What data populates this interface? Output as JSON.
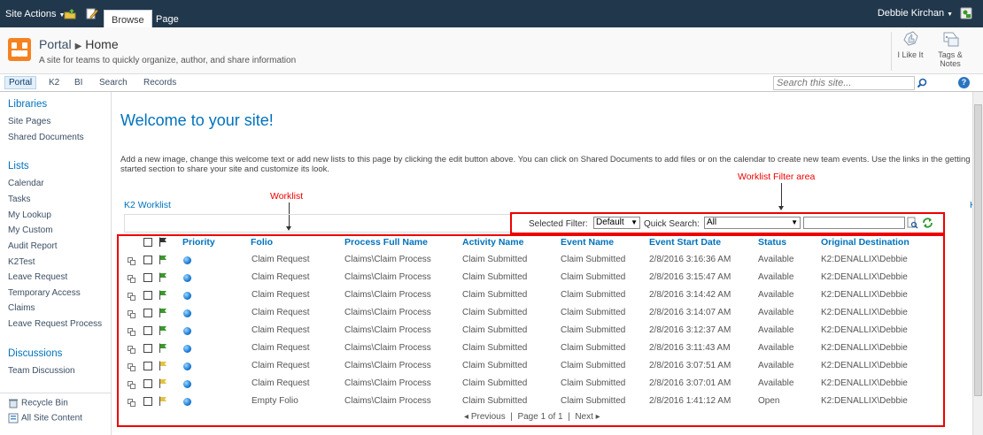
{
  "ribbon": {
    "site_actions": "Site Actions",
    "tabs": [
      "Browse",
      "Page"
    ],
    "user": "Debbie Kirchan"
  },
  "titlearea": {
    "site": "Portal",
    "page": "Home",
    "description": "A site for teams to quickly organize, author, and share information",
    "like_label": "I Like It",
    "tags_label_1": "Tags &",
    "tags_label_2": "Notes"
  },
  "topnav": {
    "items": [
      "Portal",
      "K2",
      "BI",
      "Search",
      "Records"
    ],
    "search_placeholder": "Search this site..."
  },
  "leftnav": {
    "libraries_head": "Libraries",
    "libraries": [
      "Site Pages",
      "Shared Documents"
    ],
    "lists_head": "Lists",
    "lists": [
      "Calendar",
      "Tasks",
      "My Lookup",
      "My Custom",
      "Audit Report",
      "K2Test",
      "Leave Request",
      "Temporary Access",
      "Claims",
      "Leave Request Process"
    ],
    "discussions_head": "Discussions",
    "discussions": [
      "Team Discussion"
    ],
    "recycle": "Recycle Bin",
    "all_content": "All Site Content"
  },
  "main": {
    "welcome": "Welcome to your site!",
    "body": "Add a new image, change this welcome text or add new lists to this page by clicking the edit button above. You can click on Shared Documents to add files or on the calendar to create new team events. Use the links in the getting started section to share your site and customize its look.",
    "k2_title": "K2 Worklist",
    "cut_letter": "K"
  },
  "annotations": {
    "worklist": "Worklist",
    "filter_area": "Worklist Filter area"
  },
  "filter": {
    "selected_label": "Selected Filter:",
    "selected_value": "Default",
    "quick_label": "Quick Search:",
    "quick_value": "All"
  },
  "worklist": {
    "columns": [
      "Priority",
      "Folio",
      "Process Full Name",
      "Activity Name",
      "Event Name",
      "Event Start Date",
      "Status",
      "Original Destination"
    ],
    "rows": [
      {
        "flag": "green",
        "folio": "Claim Request",
        "process": "Claims\\Claim Process",
        "activity": "Claim Submitted",
        "event": "Claim Submitted",
        "start": "2/8/2016 3:16:36 AM",
        "status": "Available",
        "dest": "K2:DENALLIX\\Debbie"
      },
      {
        "flag": "green",
        "folio": "Claim Request",
        "process": "Claims\\Claim Process",
        "activity": "Claim Submitted",
        "event": "Claim Submitted",
        "start": "2/8/2016 3:15:47 AM",
        "status": "Available",
        "dest": "K2:DENALLIX\\Debbie"
      },
      {
        "flag": "green",
        "folio": "Claim Request",
        "process": "Claims\\Claim Process",
        "activity": "Claim Submitted",
        "event": "Claim Submitted",
        "start": "2/8/2016 3:14:42 AM",
        "status": "Available",
        "dest": "K2:DENALLIX\\Debbie"
      },
      {
        "flag": "green",
        "folio": "Claim Request",
        "process": "Claims\\Claim Process",
        "activity": "Claim Submitted",
        "event": "Claim Submitted",
        "start": "2/8/2016 3:14:07 AM",
        "status": "Available",
        "dest": "K2:DENALLIX\\Debbie"
      },
      {
        "flag": "green",
        "folio": "Claim Request",
        "process": "Claims\\Claim Process",
        "activity": "Claim Submitted",
        "event": "Claim Submitted",
        "start": "2/8/2016 3:12:37 AM",
        "status": "Available",
        "dest": "K2:DENALLIX\\Debbie"
      },
      {
        "flag": "green",
        "folio": "Claim Request",
        "process": "Claims\\Claim Process",
        "activity": "Claim Submitted",
        "event": "Claim Submitted",
        "start": "2/8/2016 3:11:43 AM",
        "status": "Available",
        "dest": "K2:DENALLIX\\Debbie"
      },
      {
        "flag": "yellow",
        "folio": "Claim Request",
        "process": "Claims\\Claim Process",
        "activity": "Claim Submitted",
        "event": "Claim Submitted",
        "start": "2/8/2016 3:07:51 AM",
        "status": "Available",
        "dest": "K2:DENALLIX\\Debbie"
      },
      {
        "flag": "yellow",
        "folio": "Claim Request",
        "process": "Claims\\Claim Process",
        "activity": "Claim Submitted",
        "event": "Claim Submitted",
        "start": "2/8/2016 3:07:01 AM",
        "status": "Available",
        "dest": "K2:DENALLIX\\Debbie"
      },
      {
        "flag": "yellow",
        "folio": "Empty Folio",
        "process": "Claims\\Claim Process",
        "activity": "Claim Submitted",
        "event": "Claim Submitted",
        "start": "2/8/2016 1:41:12 AM",
        "status": "Open",
        "dest": "K2:DENALLIX\\Debbie"
      }
    ],
    "pager": {
      "prev": "Previous",
      "page": "Page 1 of 1",
      "next": "Next"
    }
  },
  "colors": {
    "ribbon": "#21374c",
    "link": "#0072bc",
    "annotation": "#e00000",
    "flag_green": "#3a9a2a",
    "flag_yellow": "#e2c243"
  }
}
